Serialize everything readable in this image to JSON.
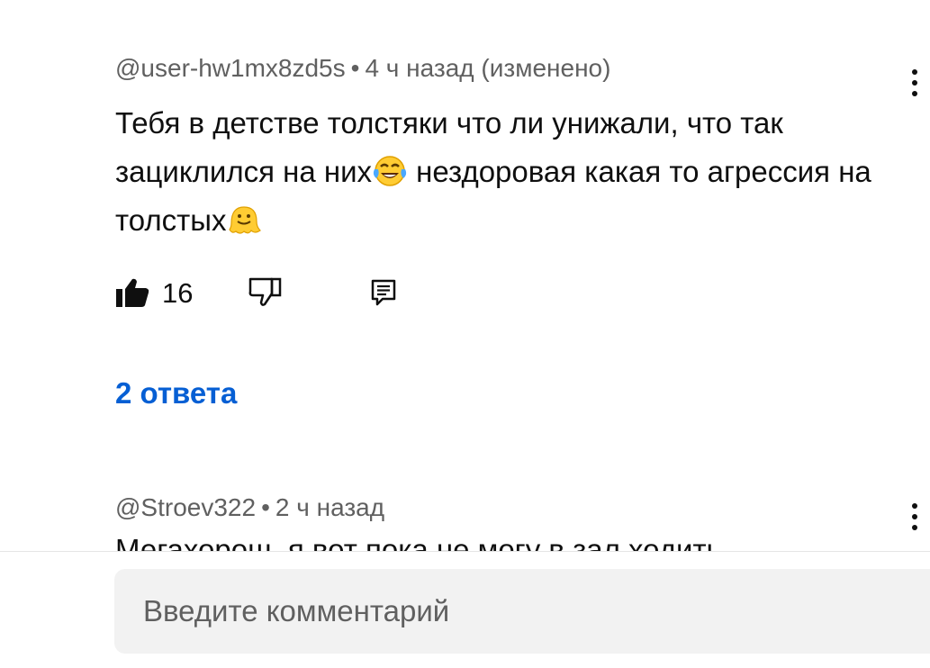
{
  "comment1": {
    "author": "@user-hw1mx8zd5s",
    "separator": "•",
    "time": "4 ч назад (изменено)",
    "text_parts": [
      "Тебя в детстве толстяки что ли унижали, что так зациклился на них",
      " нездоровая какая то агрессия на толстых",
      ""
    ],
    "emoji": [
      "face-with-tears-of-joy",
      "melting-face"
    ],
    "likes": "16",
    "replies_label": "2 ответа"
  },
  "comment2": {
    "author": "@Stroev322",
    "separator": "•",
    "time": "2 ч назад",
    "text_partial": "Мегахорош, я вот пока не могу в зал ходить"
  },
  "composer": {
    "placeholder": "Введите комментарий"
  },
  "icons": [
    "like-icon",
    "dislike-icon",
    "reply-icon",
    "more-vert-icon"
  ],
  "colors": {
    "link": "#065fd4",
    "meta": "#606060",
    "text": "#0f0f0f",
    "input_bg": "#f2f2f2"
  }
}
